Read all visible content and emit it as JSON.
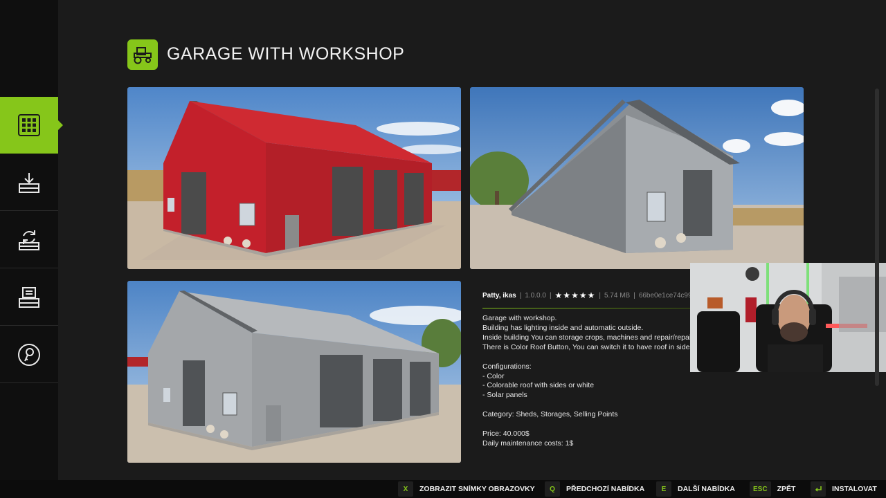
{
  "sidebar": {
    "items": [
      {
        "icon": "grid-icon",
        "active": true
      },
      {
        "icon": "download-icon",
        "active": false
      },
      {
        "icon": "update-icon",
        "active": false
      },
      {
        "icon": "installed-mods-icon",
        "active": false
      },
      {
        "icon": "key-icon",
        "active": false
      }
    ]
  },
  "header": {
    "icon": "tractor-icon",
    "title": "GARAGE WITH WORKSHOP"
  },
  "gallery": {
    "screenshots": [
      "red-garage-front",
      "grey-garage-side",
      "grey-garage-front"
    ]
  },
  "details": {
    "author": "Patty, ikas",
    "version": "1.0.0.0",
    "rating_stars": "★★★★★",
    "size": "5.74 MB",
    "hash": "66be0e1ce74c996",
    "sep": "|",
    "description": [
      "Garage with workshop.",
      "Building has lighting inside and automatic outside.",
      "Inside building You can storage crops, machines and repair/repaint",
      "There is Color Roof Button, You can switch it to have roof in sides o"
    ],
    "configurations_title": "Configurations:",
    "configurations": [
      "- Color",
      "- Colorable roof with sides or white",
      "- Solar panels"
    ],
    "category": "Category: Sheds, Storages, Selling Points",
    "price": "Price: 40.000$",
    "maintenance": "Daily maintenance costs: 1$"
  },
  "footer": {
    "actions": [
      {
        "key": "X",
        "label": "ZOBRAZIT SNÍMKY OBRAZOVKY"
      },
      {
        "key": "Q",
        "label": "PŘEDCHOZÍ NABÍDKA"
      },
      {
        "key": "E",
        "label": "DALŠÍ NABÍDKA"
      },
      {
        "key": "ESC",
        "label": "ZPĚT"
      },
      {
        "key": "enter-icon",
        "label": "INSTALOVAT"
      }
    ]
  },
  "colors": {
    "accent": "#86c61a",
    "background": "#1b1b1b",
    "sidebar": "#0f0f0f"
  }
}
